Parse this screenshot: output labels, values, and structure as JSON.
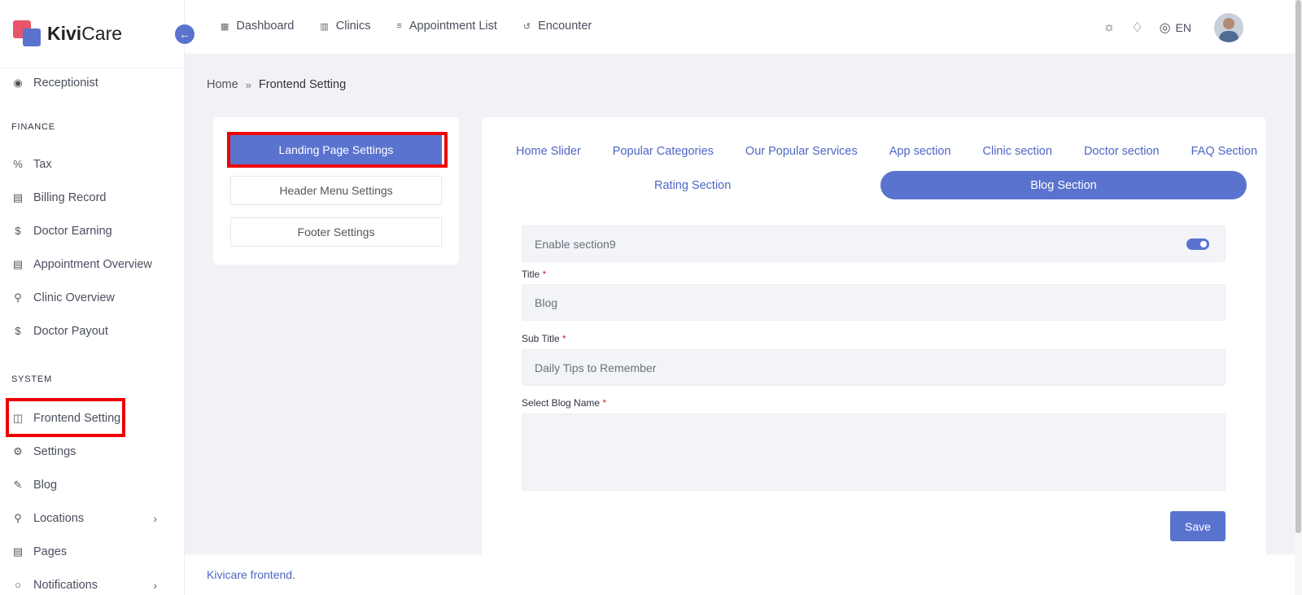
{
  "brand": {
    "name_bold": "Kivi",
    "name_rest": "Care"
  },
  "sidebar": {
    "items_top": [
      {
        "label": "Receptionist",
        "icon": "receptionist-icon"
      }
    ],
    "finance_title": "FINANCE",
    "finance_items": [
      {
        "label": "Tax",
        "icon": "percent-icon"
      },
      {
        "label": "Billing Record",
        "icon": "billing-icon"
      },
      {
        "label": "Doctor Earning",
        "icon": "dollar-icon"
      },
      {
        "label": "Appointment Overview",
        "icon": "report-icon"
      },
      {
        "label": "Clinic Overview",
        "icon": "location-pin-icon"
      },
      {
        "label": "Doctor Payout",
        "icon": "dollar-icon"
      }
    ],
    "system_title": "SYSTEM",
    "system_items": [
      {
        "label": "Frontend Setting",
        "icon": "layout-icon"
      },
      {
        "label": "Settings",
        "icon": "gear-icon"
      },
      {
        "label": "Blog",
        "icon": "pencil-icon"
      },
      {
        "label": "Locations",
        "icon": "location-icon"
      },
      {
        "label": "Pages",
        "icon": "pages-icon"
      },
      {
        "label": "Notifications",
        "icon": "bell-icon"
      }
    ]
  },
  "topbar": {
    "nav": [
      {
        "label": "Dashboard",
        "icon": "grid-icon"
      },
      {
        "label": "Clinics",
        "icon": "building-icon"
      },
      {
        "label": "Appointment List",
        "icon": "sliders-icon"
      },
      {
        "label": "Encounter",
        "icon": "history-icon"
      }
    ],
    "language": "EN"
  },
  "breadcrumb": {
    "home": "Home",
    "current": "Frontend Setting"
  },
  "settings_menu": [
    {
      "label": "Landing Page Settings",
      "active": true
    },
    {
      "label": "Header Menu Settings",
      "active": false
    },
    {
      "label": "Footer Settings",
      "active": false
    }
  ],
  "tabs": {
    "row1": [
      "Home Slider",
      "Popular Categories",
      "Our Popular Services",
      "App section",
      "Clinic section",
      "Doctor section",
      "FAQ Section"
    ],
    "rating": "Rating Section",
    "blog": "Blog Section"
  },
  "form": {
    "enable_label": "Enable section9",
    "enabled": true,
    "title_label": "Title",
    "title_value": "Blog",
    "subtitle_label": "Sub Title",
    "subtitle_value": "Daily Tips to Remember",
    "blog_name_label": "Select Blog Name",
    "required_mark": "*",
    "save_label": "Save"
  },
  "footer": {
    "link": "Kivicare frontend",
    "suffix": "."
  },
  "colors": {
    "accent": "#5a73cf",
    "highlight": "#ee0000"
  }
}
